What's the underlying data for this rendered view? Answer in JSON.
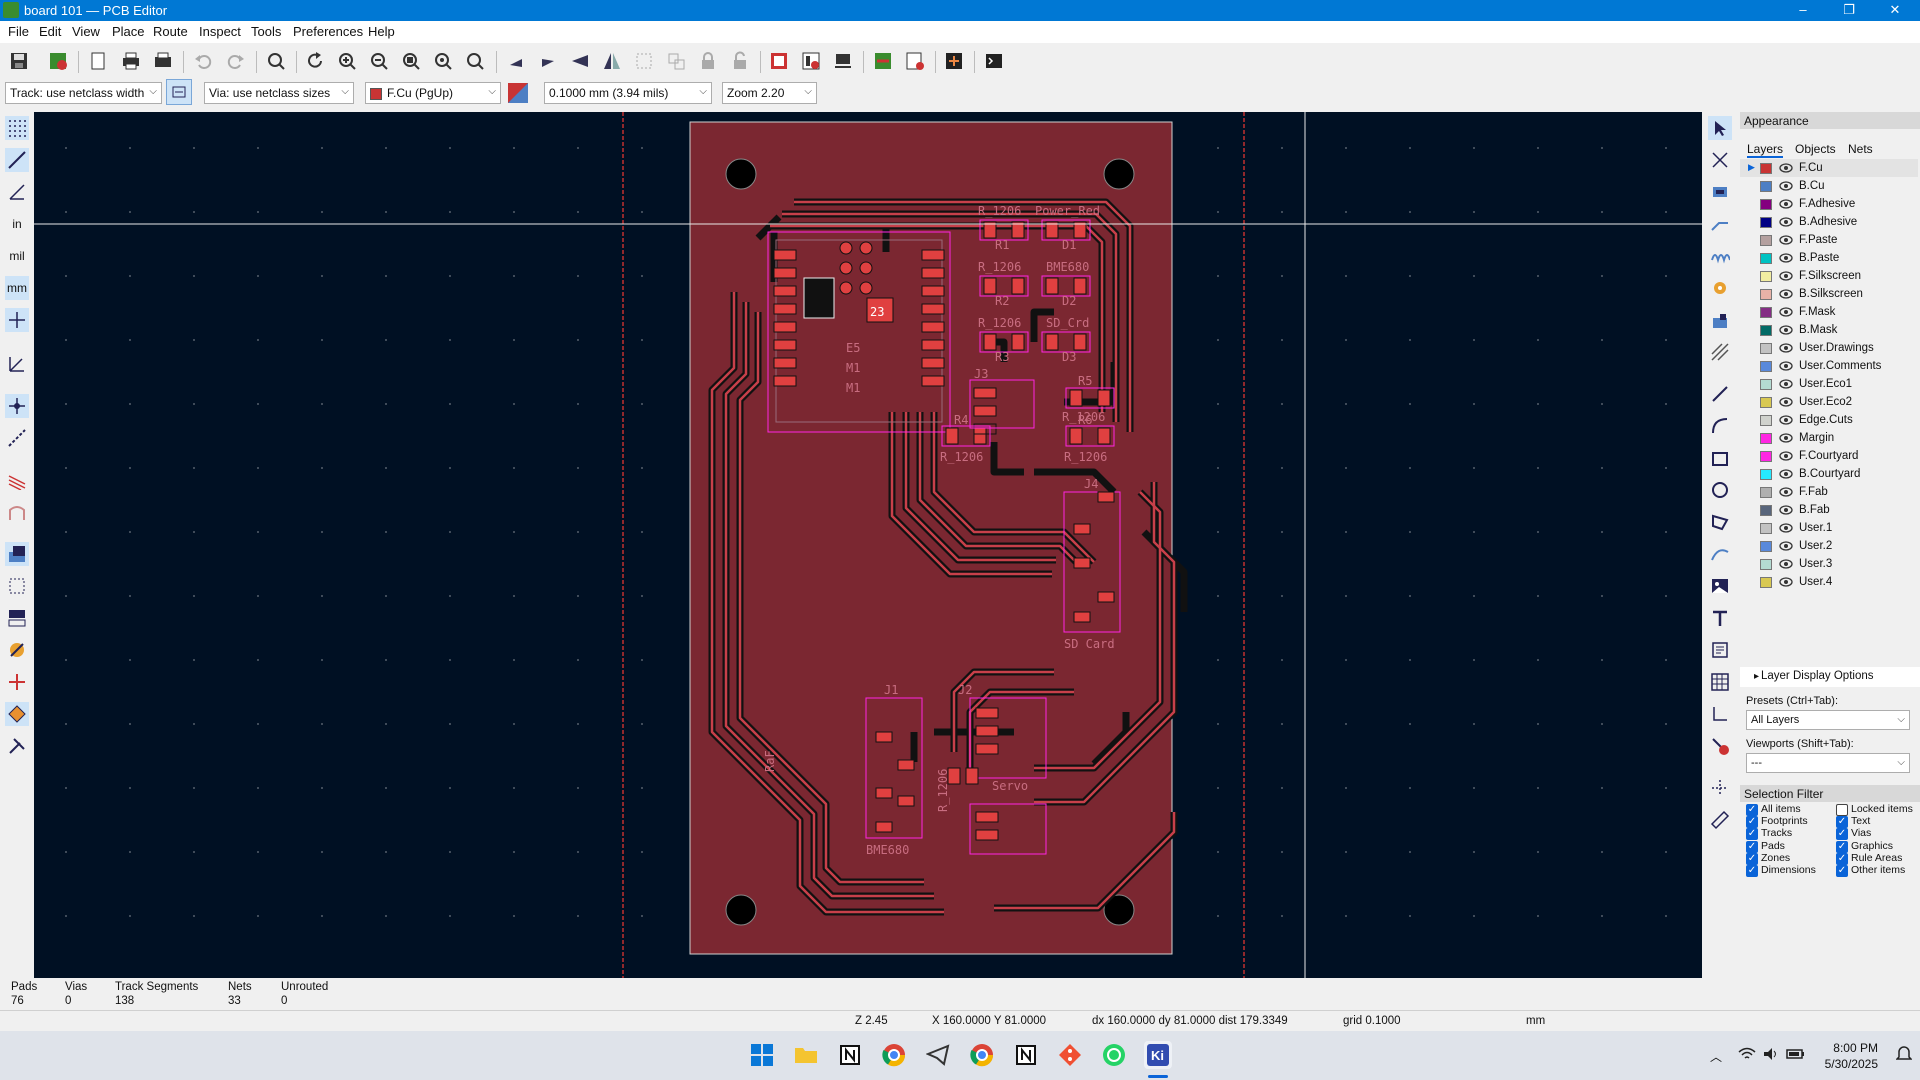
{
  "window": {
    "title": "board 101 — PCB Editor",
    "controls": [
      "–",
      "❐",
      "✕"
    ]
  },
  "menu": [
    "File",
    "Edit",
    "View",
    "Place",
    "Route",
    "Inspect",
    "Tools",
    "Preferences",
    "Help"
  ],
  "toolbar": {
    "track_width": "Track: use netclass width",
    "via_size": "Via: use netclass sizes",
    "layer": "F.Cu (PgUp)",
    "grid": "0.1000 mm (3.94 mils)",
    "zoom": "Zoom 2.20"
  },
  "left_toolbar": {
    "units_in": "in",
    "units_mil": "mil",
    "units_mm": "mm"
  },
  "appearance": {
    "title": "Appearance",
    "tabs": [
      "Layers",
      "Objects",
      "Nets"
    ],
    "layers": [
      {
        "name": "F.Cu",
        "color": "#c83434",
        "active": true
      },
      {
        "name": "B.Cu",
        "color": "#4d7fc4"
      },
      {
        "name": "F.Adhesive",
        "color": "#84007f"
      },
      {
        "name": "B.Adhesive",
        "color": "#000084"
      },
      {
        "name": "F.Paste",
        "color": "#b4a09f"
      },
      {
        "name": "B.Paste",
        "color": "#00c2c2"
      },
      {
        "name": "F.Silkscreen",
        "color": "#f2eda1"
      },
      {
        "name": "B.Silkscreen",
        "color": "#e8b2a7"
      },
      {
        "name": "F.Mask",
        "color": "#842d84"
      },
      {
        "name": "B.Mask",
        "color": "#026a66"
      },
      {
        "name": "User.Drawings",
        "color": "#c2c2c2"
      },
      {
        "name": "User.Comments",
        "color": "#5989db"
      },
      {
        "name": "User.Eco1",
        "color": "#b4dbd2"
      },
      {
        "name": "User.Eco2",
        "color": "#d8c852"
      },
      {
        "name": "Edge.Cuts",
        "color": "#d0d2cd"
      },
      {
        "name": "Margin",
        "color": "#ff26e2"
      },
      {
        "name": "F.Courtyard",
        "color": "#ff26e2"
      },
      {
        "name": "B.Courtyard",
        "color": "#26e9ff"
      },
      {
        "name": "F.Fab",
        "color": "#afafaf"
      },
      {
        "name": "B.Fab",
        "color": "#58657b"
      },
      {
        "name": "User.1",
        "color": "#c2c2c2"
      },
      {
        "name": "User.2",
        "color": "#5989db"
      },
      {
        "name": "User.3",
        "color": "#b4dbd2"
      },
      {
        "name": "User.4",
        "color": "#d8c852"
      }
    ],
    "layer_display_options": "Layer Display Options",
    "presets_label": "Presets (Ctrl+Tab):",
    "presets_value": "All Layers",
    "viewports_label": "Viewports (Shift+Tab):",
    "viewports_value": "---"
  },
  "selection_filter": {
    "title": "Selection Filter",
    "left": [
      {
        "label": "All items",
        "checked": true
      },
      {
        "label": "Footprints",
        "checked": true
      },
      {
        "label": "Tracks",
        "checked": true
      },
      {
        "label": "Pads",
        "checked": true
      },
      {
        "label": "Zones",
        "checked": true
      },
      {
        "label": "Dimensions",
        "checked": true
      }
    ],
    "right": [
      {
        "label": "Locked items",
        "checked": false
      },
      {
        "label": "Text",
        "checked": true
      },
      {
        "label": "Vias",
        "checked": true
      },
      {
        "label": "Graphics",
        "checked": true
      },
      {
        "label": "Rule Areas",
        "checked": true
      },
      {
        "label": "Other items",
        "checked": true
      }
    ]
  },
  "board": {
    "labels": {
      "r1_val": "R_1206",
      "r1_ref": "R1",
      "d1_val": "Power_Red",
      "d1_ref": "D1",
      "r2_val": "R_1206",
      "r2_ref": "R2",
      "d2_val": "BME680",
      "d2_ref": "D2",
      "r3_val": "R_1206",
      "r3_ref": "R3",
      "d3_val": "SD_Crd",
      "d3_ref": "D3",
      "j3": "J3",
      "r5_ref": "R5",
      "r5_val": "R_1206",
      "r4_ref": "R4",
      "r4_val": "R_1206",
      "r6_ref": "R6",
      "r6_val": "R_1206",
      "j4": "J4",
      "sd_card": "SD Card",
      "j1": "J1",
      "j2": "J2",
      "servo": "Servo",
      "bme680": "BME680",
      "r7_val": "R_1206",
      "ref_vert": "RaF",
      "u1_m1": "M1",
      "u1_m1b": "M1",
      "chip_num": "23",
      "e5": "E5"
    }
  },
  "status": {
    "pads_label": "Pads",
    "pads": "76",
    "vias_label": "Vias",
    "vias": "0",
    "tracks_label": "Track Segments",
    "tracks": "138",
    "nets_label": "Nets",
    "nets": "33",
    "unrouted_label": "Unrouted",
    "unrouted": "0",
    "zoom": "Z 2.45",
    "coords": "X 160.0000  Y 81.0000",
    "delta": "dx 160.0000  dy 81.0000  dist 179.3349",
    "grid": "grid 0.1000",
    "units": "mm"
  },
  "taskbar": {
    "time": "8:00 PM",
    "date": "5/30/2025"
  }
}
